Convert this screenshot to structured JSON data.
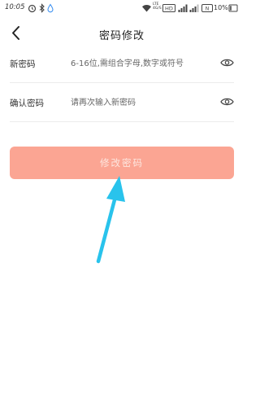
{
  "status_bar": {
    "time": "10:05",
    "network_label_1": "LTE",
    "network_label_2": "4G/S",
    "battery": "10%"
  },
  "header": {
    "title": "密码修改"
  },
  "form": {
    "new_password": {
      "label": "新密码",
      "placeholder": "6-16位,需组合字母,数字或符号",
      "value": ""
    },
    "confirm_password": {
      "label": "确认密码",
      "placeholder": "请再次输入新密码",
      "value": ""
    }
  },
  "submit": {
    "label": "修改密码"
  },
  "colors": {
    "button": "#fba593",
    "button_text": "#fde6df",
    "arrow": "#29c3ec",
    "divider": "#ececec"
  }
}
